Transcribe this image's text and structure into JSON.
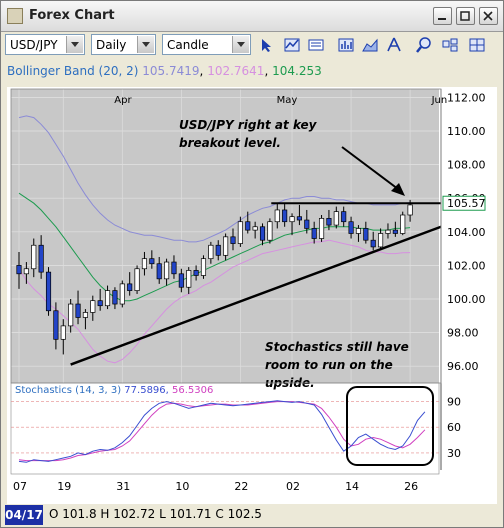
{
  "window": {
    "title": "Forex Chart",
    "buttons": [
      "minimize-button",
      "maximize-button",
      "close-button"
    ]
  },
  "toolbar": {
    "symbol": "USD/JPY",
    "period": "Daily",
    "chart_style": "Candle",
    "tools": [
      "cursor-icon",
      "line-chart-icon",
      "indicator-icon",
      "bar-chart-icon",
      "area-chart-icon",
      "draw-icon",
      "zoom-in-icon",
      "settings-icon",
      "grid-icon"
    ]
  },
  "indicator_legend": {
    "name": "Bollinger Band (20, 2)",
    "upper": "105.7419",
    "lower": "102.7641",
    "middle": "104.253",
    "colors": {
      "name": "#2e6fc0",
      "upper": "#8b8bd6",
      "lower": "#d690e0",
      "middle": "#1d9b4f"
    }
  },
  "status": {
    "date": "04/17",
    "ohlc": "O 101.8 H 102.72 L 101.71 C 102.5"
  },
  "chart_data": {
    "type": "candlestick",
    "symbol": "USD/JPY",
    "period": "Daily",
    "ylim": [
      95,
      112.5
    ],
    "yticks": [
      96,
      98,
      100,
      102,
      104,
      106,
      108,
      110,
      112
    ],
    "ytick_labels": [
      "96.00",
      "98.00",
      "100.00",
      "102.00",
      "104.00",
      "106.00",
      "108.00",
      "110.00",
      "112.00"
    ],
    "month_labels": [
      {
        "label": "Apr",
        "index": 14
      },
      {
        "label": "May",
        "index": 36
      },
      {
        "label": "Jun",
        "index": 57
      }
    ],
    "date_labels": [
      {
        "label": "07",
        "index": 0
      },
      {
        "label": "19",
        "index": 6
      },
      {
        "label": "31",
        "index": 14
      },
      {
        "label": "10",
        "index": 22
      },
      {
        "label": "22",
        "index": 30
      },
      {
        "label": "02",
        "index": 37
      },
      {
        "label": "14",
        "index": 45
      },
      {
        "label": "26",
        "index": 53
      }
    ],
    "last_price": "105.57",
    "candles": [
      [
        102.0,
        102.8,
        100.6,
        101.5
      ],
      [
        101.5,
        102.2,
        100.9,
        101.8
      ],
      [
        101.8,
        103.6,
        101.3,
        103.2
      ],
      [
        103.2,
        103.8,
        101.2,
        101.6
      ],
      [
        101.6,
        101.9,
        99.0,
        99.3
      ],
      [
        99.3,
        99.8,
        97.0,
        97.6
      ],
      [
        97.6,
        98.8,
        96.7,
        98.4
      ],
      [
        98.4,
        100.0,
        98.0,
        99.7
      ],
      [
        99.7,
        100.5,
        98.5,
        98.9
      ],
      [
        98.9,
        99.4,
        98.2,
        99.2
      ],
      [
        99.2,
        100.2,
        98.7,
        99.9
      ],
      [
        99.9,
        100.6,
        99.3,
        99.6
      ],
      [
        99.6,
        100.8,
        99.4,
        100.5
      ],
      [
        100.5,
        100.7,
        99.4,
        99.7
      ],
      [
        99.7,
        101.1,
        99.5,
        100.9
      ],
      [
        100.9,
        101.6,
        100.2,
        100.5
      ],
      [
        100.5,
        102.0,
        100.3,
        101.8
      ],
      [
        101.8,
        102.8,
        101.4,
        102.4
      ],
      [
        102.4,
        102.9,
        101.8,
        102.1
      ],
      [
        102.1,
        102.5,
        100.9,
        101.2
      ],
      [
        101.2,
        102.4,
        100.8,
        102.2
      ],
      [
        102.2,
        102.6,
        101.2,
        101.5
      ],
      [
        101.5,
        101.8,
        100.4,
        100.7
      ],
      [
        100.7,
        101.9,
        100.3,
        101.7
      ],
      [
        101.7,
        102.0,
        101.1,
        101.4
      ],
      [
        101.4,
        102.6,
        101.2,
        102.4
      ],
      [
        102.4,
        103.4,
        102.1,
        103.2
      ],
      [
        103.2,
        103.5,
        102.3,
        102.6
      ],
      [
        102.6,
        103.9,
        102.3,
        103.7
      ],
      [
        103.7,
        104.2,
        102.9,
        103.3
      ],
      [
        103.3,
        104.9,
        103.1,
        104.6
      ],
      [
        104.6,
        105.2,
        103.9,
        104.1
      ],
      [
        104.1,
        104.6,
        103.6,
        104.3
      ],
      [
        104.3,
        104.5,
        103.2,
        103.5
      ],
      [
        103.5,
        104.8,
        103.3,
        104.6
      ],
      [
        104.6,
        105.7,
        104.2,
        105.3
      ],
      [
        105.3,
        105.7,
        104.3,
        104.6
      ],
      [
        104.6,
        105.1,
        103.8,
        104.9
      ],
      [
        104.9,
        105.6,
        104.4,
        104.7
      ],
      [
        104.7,
        105.3,
        103.9,
        104.2
      ],
      [
        104.2,
        104.6,
        103.3,
        103.6
      ],
      [
        103.6,
        105.0,
        103.4,
        104.8
      ],
      [
        104.8,
        105.3,
        104.1,
        104.4
      ],
      [
        104.4,
        105.5,
        104.2,
        105.2
      ],
      [
        105.2,
        105.5,
        104.3,
        104.6
      ],
      [
        104.6,
        104.9,
        103.6,
        103.9
      ],
      [
        103.9,
        104.4,
        103.4,
        104.2
      ],
      [
        104.2,
        104.6,
        103.3,
        103.5
      ],
      [
        103.5,
        104.0,
        102.9,
        103.1
      ],
      [
        103.1,
        104.2,
        102.9,
        103.9
      ],
      [
        103.9,
        104.5,
        103.6,
        104.1
      ],
      [
        104.1,
        104.6,
        103.7,
        103.9
      ],
      [
        103.9,
        105.2,
        103.8,
        105.0
      ],
      [
        105.0,
        105.9,
        104.6,
        105.6
      ]
    ],
    "bollinger": {
      "label": "Bollinger Band (20, 2)",
      "upper": [
        110.8,
        110.9,
        110.8,
        110.4,
        109.9,
        109.2,
        108.5,
        107.7,
        106.9,
        106.2,
        105.6,
        105.1,
        104.7,
        104.4,
        104.2,
        104.0,
        103.9,
        103.8,
        103.8,
        103.7,
        103.6,
        103.5,
        103.5,
        103.4,
        103.4,
        103.5,
        103.7,
        103.9,
        104.1,
        104.4,
        104.7,
        105.0,
        105.2,
        105.4,
        105.5,
        105.7,
        105.9,
        106.0,
        106.0,
        106.1,
        106.1,
        106.0,
        106.0,
        105.9,
        105.9,
        105.8,
        105.7,
        105.7,
        105.6,
        105.6,
        105.6,
        105.6,
        105.7,
        105.74
      ],
      "middle": [
        106.3,
        106.0,
        105.7,
        105.3,
        104.8,
        104.3,
        103.7,
        103.1,
        102.5,
        101.9,
        101.3,
        100.8,
        100.4,
        100.1,
        99.9,
        99.9,
        100.0,
        100.2,
        100.4,
        100.6,
        100.8,
        101.0,
        101.1,
        101.3,
        101.5,
        101.7,
        101.9,
        102.1,
        102.3,
        102.5,
        102.7,
        102.9,
        103.1,
        103.3,
        103.4,
        103.6,
        103.8,
        103.9,
        104.0,
        104.1,
        104.2,
        104.2,
        104.3,
        104.3,
        104.3,
        104.3,
        104.2,
        104.2,
        104.1,
        104.1,
        104.1,
        104.2,
        104.2,
        104.25
      ],
      "lower": [
        101.8,
        101.1,
        100.6,
        100.2,
        99.7,
        99.4,
        99.0,
        98.6,
        98.2,
        97.6,
        97.0,
        96.6,
        96.3,
        96.2,
        96.4,
        96.8,
        97.3,
        97.9,
        98.4,
        98.9,
        99.4,
        99.8,
        100.1,
        100.3,
        100.5,
        100.8,
        101.0,
        101.3,
        101.6,
        101.9,
        102.1,
        102.3,
        102.5,
        102.7,
        102.8,
        102.9,
        103.0,
        103.1,
        103.2,
        103.3,
        103.4,
        103.4,
        103.5,
        103.4,
        103.3,
        103.2,
        103.1,
        102.9,
        102.8,
        102.8,
        102.7,
        102.7,
        102.75,
        102.76
      ]
    },
    "annotations": [
      {
        "text": "USD/JPY right at key breakout level.",
        "lines": [
          "USD/JPY right at key",
          "breakout level."
        ]
      },
      {
        "text": "Stochastics still have room to run on the upside.",
        "lines": [
          "Stochastics still have",
          "room to run on the",
          "upside."
        ]
      }
    ],
    "resistance_level": 105.7,
    "support_trend": {
      "from": {
        "index": 7,
        "value": 96.1
      },
      "to": {
        "index": 57,
        "value": 104.3
      }
    },
    "stochastics": {
      "label": "Stochastics (14, 3, 3)",
      "k_value": "77.5896",
      "d_value": "56.5306",
      "ylim": [
        10,
        100
      ],
      "yticks": [
        30,
        60,
        90
      ],
      "k_color": "#3a4ed0",
      "d_color": "#d040c0",
      "k": [
        20,
        19,
        22,
        21,
        20,
        22,
        24,
        26,
        30,
        28,
        32,
        34,
        33,
        36,
        42,
        50,
        62,
        74,
        82,
        88,
        90,
        88,
        85,
        82,
        84,
        86,
        88,
        87,
        86,
        85,
        86,
        87,
        88,
        89,
        90,
        91,
        90,
        89,
        90,
        88,
        86,
        75,
        60,
        45,
        32,
        38,
        48,
        52,
        46,
        40,
        36,
        34,
        38,
        50,
        68,
        78
      ],
      "d": [
        22,
        21,
        21,
        21,
        21,
        21,
        22,
        24,
        27,
        28,
        30,
        32,
        33,
        34,
        38,
        44,
        54,
        64,
        74,
        82,
        87,
        88,
        87,
        85,
        84,
        85,
        86,
        87,
        87,
        86,
        86,
        86,
        87,
        88,
        89,
        90,
        90,
        90,
        89,
        88,
        87,
        82,
        72,
        60,
        46,
        38,
        40,
        46,
        48,
        46,
        42,
        38,
        36,
        40,
        48,
        57
      ]
    },
    "colors": {
      "bullish_candle": "#ffffff",
      "bearish_candle": "#2345c8",
      "upper_band": "#8b8bd6",
      "middle_band": "#1d9b4f",
      "lower_band": "#d690e0",
      "plot_bg": "#c8c8c8"
    }
  }
}
